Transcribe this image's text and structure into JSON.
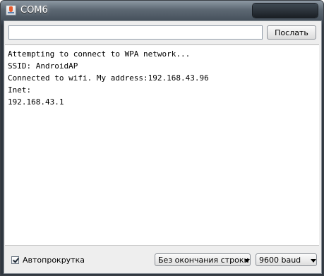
{
  "window": {
    "title": "COM6"
  },
  "send": {
    "input_value": "",
    "button_label": "Послать"
  },
  "console": {
    "lines": [
      "Attempting to connect to WPA network...",
      "SSID: AndroidAP",
      "Connected to wifi. My address:192.168.43.96",
      "Inet:",
      "192.168.43.1"
    ]
  },
  "status": {
    "autoscroll_label": "Автопрокрутка",
    "autoscroll_checked": true,
    "line_ending": "Без окончания строки",
    "baud_rate": "9600 baud"
  },
  "icons": {
    "app": "arduino-app-icon",
    "checkbox": "checkmark-icon",
    "dropdown": "dropdown-arrow-icon"
  }
}
